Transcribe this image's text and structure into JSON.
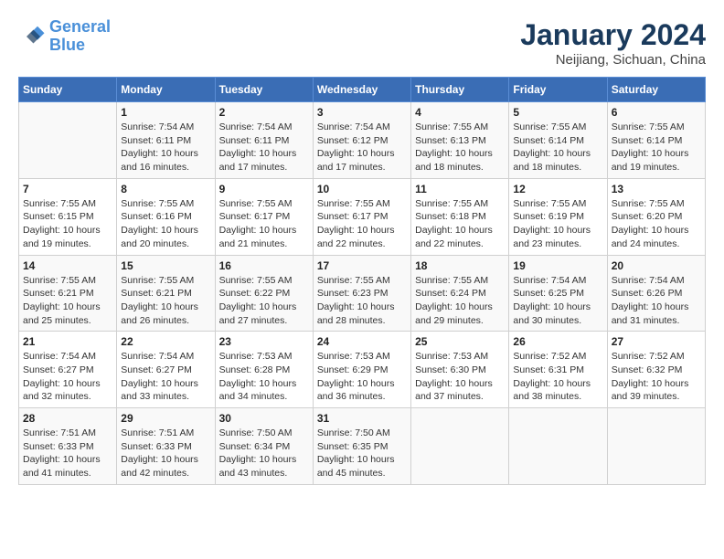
{
  "header": {
    "logo_line1": "General",
    "logo_line2": "Blue",
    "month_title": "January 2024",
    "location": "Neijiang, Sichuan, China"
  },
  "weekdays": [
    "Sunday",
    "Monday",
    "Tuesday",
    "Wednesday",
    "Thursday",
    "Friday",
    "Saturday"
  ],
  "weeks": [
    [
      {
        "day": "",
        "info": ""
      },
      {
        "day": "1",
        "info": "Sunrise: 7:54 AM\nSunset: 6:11 PM\nDaylight: 10 hours\nand 16 minutes."
      },
      {
        "day": "2",
        "info": "Sunrise: 7:54 AM\nSunset: 6:11 PM\nDaylight: 10 hours\nand 17 minutes."
      },
      {
        "day": "3",
        "info": "Sunrise: 7:54 AM\nSunset: 6:12 PM\nDaylight: 10 hours\nand 17 minutes."
      },
      {
        "day": "4",
        "info": "Sunrise: 7:55 AM\nSunset: 6:13 PM\nDaylight: 10 hours\nand 18 minutes."
      },
      {
        "day": "5",
        "info": "Sunrise: 7:55 AM\nSunset: 6:14 PM\nDaylight: 10 hours\nand 18 minutes."
      },
      {
        "day": "6",
        "info": "Sunrise: 7:55 AM\nSunset: 6:14 PM\nDaylight: 10 hours\nand 19 minutes."
      }
    ],
    [
      {
        "day": "7",
        "info": "Sunrise: 7:55 AM\nSunset: 6:15 PM\nDaylight: 10 hours\nand 19 minutes."
      },
      {
        "day": "8",
        "info": "Sunrise: 7:55 AM\nSunset: 6:16 PM\nDaylight: 10 hours\nand 20 minutes."
      },
      {
        "day": "9",
        "info": "Sunrise: 7:55 AM\nSunset: 6:17 PM\nDaylight: 10 hours\nand 21 minutes."
      },
      {
        "day": "10",
        "info": "Sunrise: 7:55 AM\nSunset: 6:17 PM\nDaylight: 10 hours\nand 22 minutes."
      },
      {
        "day": "11",
        "info": "Sunrise: 7:55 AM\nSunset: 6:18 PM\nDaylight: 10 hours\nand 22 minutes."
      },
      {
        "day": "12",
        "info": "Sunrise: 7:55 AM\nSunset: 6:19 PM\nDaylight: 10 hours\nand 23 minutes."
      },
      {
        "day": "13",
        "info": "Sunrise: 7:55 AM\nSunset: 6:20 PM\nDaylight: 10 hours\nand 24 minutes."
      }
    ],
    [
      {
        "day": "14",
        "info": "Sunrise: 7:55 AM\nSunset: 6:21 PM\nDaylight: 10 hours\nand 25 minutes."
      },
      {
        "day": "15",
        "info": "Sunrise: 7:55 AM\nSunset: 6:21 PM\nDaylight: 10 hours\nand 26 minutes."
      },
      {
        "day": "16",
        "info": "Sunrise: 7:55 AM\nSunset: 6:22 PM\nDaylight: 10 hours\nand 27 minutes."
      },
      {
        "day": "17",
        "info": "Sunrise: 7:55 AM\nSunset: 6:23 PM\nDaylight: 10 hours\nand 28 minutes."
      },
      {
        "day": "18",
        "info": "Sunrise: 7:55 AM\nSunset: 6:24 PM\nDaylight: 10 hours\nand 29 minutes."
      },
      {
        "day": "19",
        "info": "Sunrise: 7:54 AM\nSunset: 6:25 PM\nDaylight: 10 hours\nand 30 minutes."
      },
      {
        "day": "20",
        "info": "Sunrise: 7:54 AM\nSunset: 6:26 PM\nDaylight: 10 hours\nand 31 minutes."
      }
    ],
    [
      {
        "day": "21",
        "info": "Sunrise: 7:54 AM\nSunset: 6:27 PM\nDaylight: 10 hours\nand 32 minutes."
      },
      {
        "day": "22",
        "info": "Sunrise: 7:54 AM\nSunset: 6:27 PM\nDaylight: 10 hours\nand 33 minutes."
      },
      {
        "day": "23",
        "info": "Sunrise: 7:53 AM\nSunset: 6:28 PM\nDaylight: 10 hours\nand 34 minutes."
      },
      {
        "day": "24",
        "info": "Sunrise: 7:53 AM\nSunset: 6:29 PM\nDaylight: 10 hours\nand 36 minutes."
      },
      {
        "day": "25",
        "info": "Sunrise: 7:53 AM\nSunset: 6:30 PM\nDaylight: 10 hours\nand 37 minutes."
      },
      {
        "day": "26",
        "info": "Sunrise: 7:52 AM\nSunset: 6:31 PM\nDaylight: 10 hours\nand 38 minutes."
      },
      {
        "day": "27",
        "info": "Sunrise: 7:52 AM\nSunset: 6:32 PM\nDaylight: 10 hours\nand 39 minutes."
      }
    ],
    [
      {
        "day": "28",
        "info": "Sunrise: 7:51 AM\nSunset: 6:33 PM\nDaylight: 10 hours\nand 41 minutes."
      },
      {
        "day": "29",
        "info": "Sunrise: 7:51 AM\nSunset: 6:33 PM\nDaylight: 10 hours\nand 42 minutes."
      },
      {
        "day": "30",
        "info": "Sunrise: 7:50 AM\nSunset: 6:34 PM\nDaylight: 10 hours\nand 43 minutes."
      },
      {
        "day": "31",
        "info": "Sunrise: 7:50 AM\nSunset: 6:35 PM\nDaylight: 10 hours\nand 45 minutes."
      },
      {
        "day": "",
        "info": ""
      },
      {
        "day": "",
        "info": ""
      },
      {
        "day": "",
        "info": ""
      }
    ]
  ]
}
